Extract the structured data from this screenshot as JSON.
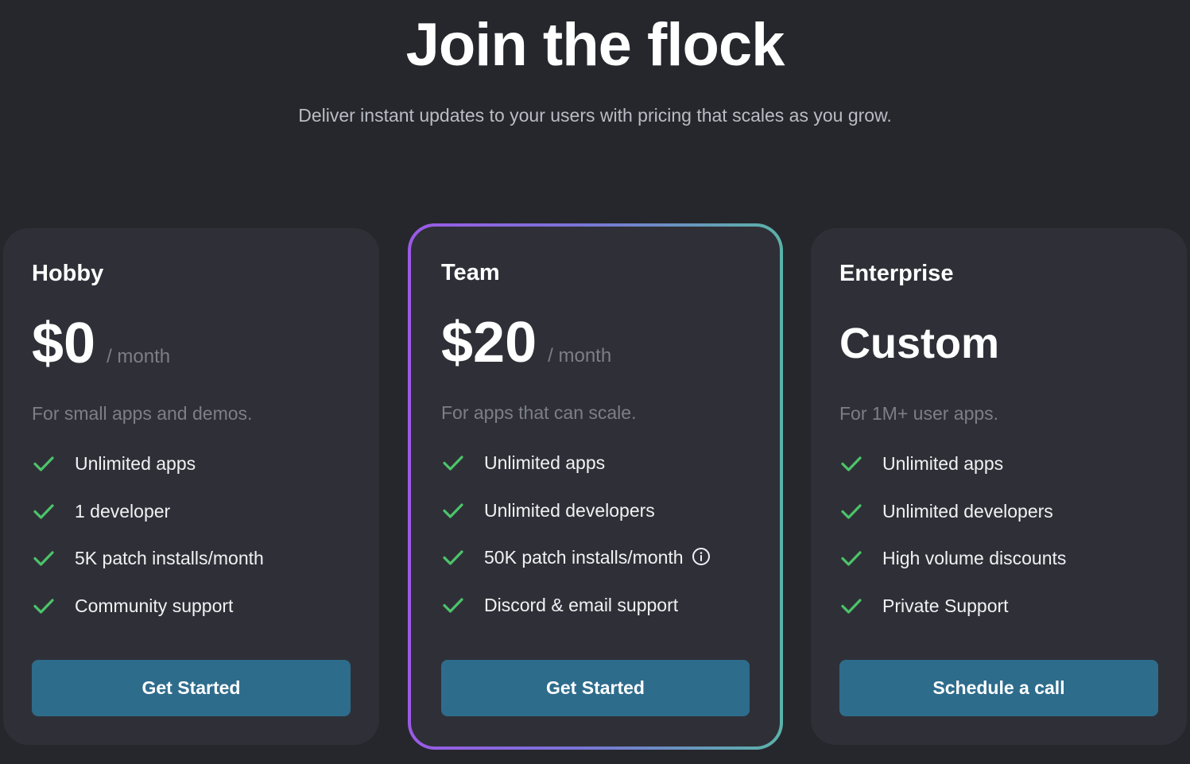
{
  "header": {
    "title": "Join the flock",
    "subtitle": "Deliver instant updates to your users with pricing that scales as you grow."
  },
  "plans": [
    {
      "name": "Hobby",
      "price": "$0",
      "period": "/ month",
      "tagline": "For small apps and demos.",
      "features": [
        "Unlimited apps",
        "1 developer",
        "5K patch installs/month",
        "Community support"
      ],
      "cta": "Get Started"
    },
    {
      "name": "Team",
      "price": "$20",
      "period": "/ month",
      "tagline": "For apps that can scale.",
      "features": [
        "Unlimited apps",
        "Unlimited developers",
        "50K patch installs/month",
        "Discord & email support"
      ],
      "cta": "Get Started",
      "highlighted": true
    },
    {
      "name": "Enterprise",
      "price": "Custom",
      "tagline": "For 1M+ user apps.",
      "features": [
        "Unlimited apps",
        "Unlimited developers",
        "High volume discounts",
        "Private Support"
      ],
      "cta": "Schedule a call"
    }
  ],
  "icons": {
    "check": "check-icon",
    "info": "info-icon"
  },
  "colors": {
    "background": "#26272c",
    "card": "#2f3037",
    "button": "#2e6c8c",
    "check": "#4cc46a",
    "highlight_gradient_start": "#9b5ae6",
    "highlight_gradient_end": "#5ab3a9"
  }
}
